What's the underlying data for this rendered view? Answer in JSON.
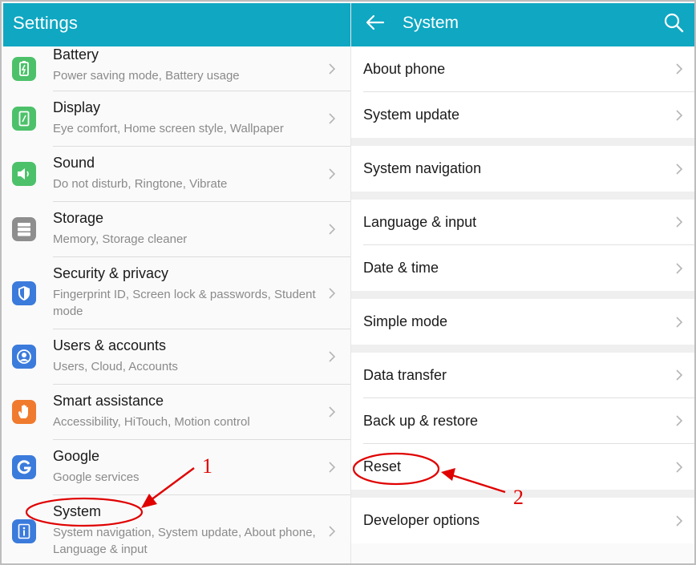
{
  "colors": {
    "header": "#0fa7c2",
    "annotation": "#e00000"
  },
  "left_panel": {
    "title": "Settings",
    "items": [
      {
        "label": "Battery",
        "sub": "Power saving mode, Battery usage",
        "icon": "battery-icon",
        "color": "#4cc16a"
      },
      {
        "label": "Display",
        "sub": "Eye comfort, Home screen style, Wallpaper",
        "icon": "display-icon",
        "color": "#4cc16a"
      },
      {
        "label": "Sound",
        "sub": "Do not disturb, Ringtone, Vibrate",
        "icon": "sound-icon",
        "color": "#4cc16a"
      },
      {
        "label": "Storage",
        "sub": "Memory, Storage cleaner",
        "icon": "storage-icon",
        "color": "#8e8e8e"
      },
      {
        "label": "Security & privacy",
        "sub": "Fingerprint ID, Screen lock & passwords, Student mode",
        "icon": "shield-icon",
        "color": "#3b7bdc"
      },
      {
        "label": "Users & accounts",
        "sub": "Users, Cloud, Accounts",
        "icon": "user-icon",
        "color": "#3b7bdc"
      },
      {
        "label": "Smart assistance",
        "sub": "Accessibility, HiTouch, Motion control",
        "icon": "hand-icon",
        "color": "#f07b2e"
      },
      {
        "label": "Google",
        "sub": "Google services",
        "icon": "google-icon",
        "color": "#3b7bdc"
      },
      {
        "label": "System",
        "sub": "System navigation, System update, About phone, Language & input",
        "icon": "info-icon",
        "color": "#3b7bdc"
      }
    ]
  },
  "right_panel": {
    "title": "System",
    "groups": [
      [
        "About phone",
        "System update"
      ],
      [
        "System navigation"
      ],
      [
        "Language & input",
        "Date & time"
      ],
      [
        "Simple mode"
      ],
      [
        "Data transfer",
        "Back up & restore",
        "Reset"
      ],
      [
        "Developer options"
      ]
    ]
  },
  "annotations": {
    "step1": "1",
    "step2": "2"
  }
}
